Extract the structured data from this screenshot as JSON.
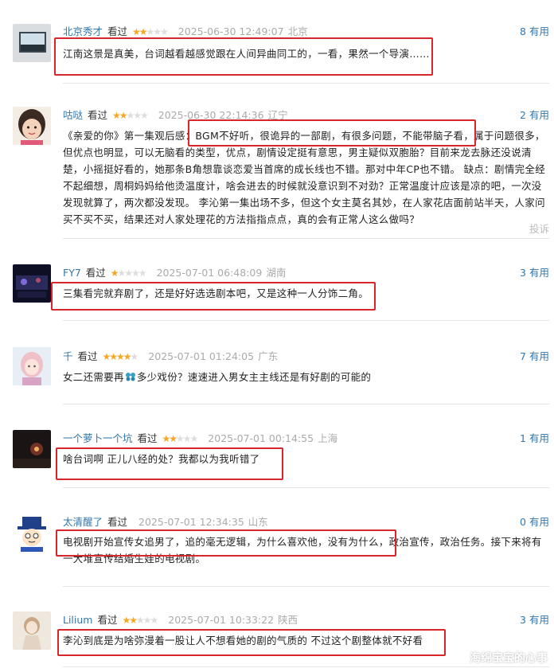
{
  "comments": [
    {
      "username": "北京秀才",
      "status": "看过",
      "rating": 2,
      "time": "2025-06-30 12:49:07",
      "location": "北京",
      "useful_count": "8",
      "useful_label": "有用",
      "text": "江南这景是真美，台词越看越感觉跟在人间异曲同工的，一看，果然一个导演……",
      "avatar_icon": "landscape-photo"
    },
    {
      "username": "咕哒",
      "status": "看过",
      "rating": 2,
      "time": "2025-06-30 22:14:36",
      "location": "辽宁",
      "useful_count": "2",
      "useful_label": "有用",
      "text": "《亲爱的你》第一集观后感：BGM不好听，很诡异的一部剧，有很多问题，不能带脑子看，属于问题很多，但优点也明显，可以无脑看的类型，优点，剧情设定挺有意思，男主疑似双胞胎？目前来龙去脉还没说清楚，小摇挺好看的，她那条B角想靠谈恋爱当首席的成长线也不错。那对中年CP也不错。 缺点：剧情完全经不起细想，周桐妈妈给他烫温度计，啥会进去的时候就没意识到不对劲？正常温度计应该是凉的吧，一次没发现就算了，两次都没发现。 李沁第一集出场不多，但这个女主莫名其妙，在人家花店面前站半天，人家问买不买不买，结果还对人家处理花的方法指指点点，真的会有正常人这么做吗？",
      "report_label": "投诉",
      "avatar_icon": "child-photo"
    },
    {
      "username": "FY7",
      "status": "看过",
      "rating": 1,
      "time": "2025-07-01 06:48:09",
      "location": "湖南",
      "useful_count": "3",
      "useful_label": "有用",
      "text": "三集看完就弃剧了，还是好好选选剧本吧，又是这种一人分饰二角。",
      "avatar_icon": "dark-scene-photo"
    },
    {
      "username": "千",
      "status": "看过",
      "rating": 4,
      "time": "2025-07-01 01:24:05",
      "location": "广东",
      "useful_count": "7",
      "useful_label": "有用",
      "text_before": "女二还需要再",
      "text_after": "多少戏份？速速进入男女主主线还是有好剧的可能的",
      "emoji_icon": "blue-flower-emoji",
      "avatar_icon": "anime-girl-photo"
    },
    {
      "username": "一个萝卜一个坑",
      "status": "看过",
      "rating": 2,
      "time": "2025-07-01 00:14:55",
      "location": "上海",
      "useful_count": "1",
      "useful_label": "有用",
      "text": "啥台词啊 正儿八经的处？我都以为我听错了",
      "avatar_icon": "night-scene-photo"
    },
    {
      "username": "太清醒了",
      "status": "看过",
      "rating": 0,
      "time": "2025-07-01 12:34:35",
      "location": "山东",
      "useful_count": "0",
      "useful_label": "有用",
      "text": "电视剧开始宣传女追男了，追的毫无逻辑，为什么喜欢他，没有为什么，政治宣传，政治任务。接下来将有一大堆宣传结婚生娃的电视剧。",
      "avatar_icon": "cartoon-kid-avatar"
    },
    {
      "username": "Lilium",
      "status": "看过",
      "rating": 2,
      "time": "2025-07-01 10:33:22",
      "location": "陕西",
      "useful_count": "3",
      "useful_label": "有用",
      "text": "李沁到底是为啥弥漫着一股让人不想看她的剧的气质的 不过这个剧整体就不好看",
      "avatar_icon": "doll-photo"
    }
  ],
  "watermark": "海绵宝宝的心事",
  "colors": {
    "link": "#3377aa",
    "star": "#f5a623",
    "highlight_box": "#d9262a"
  }
}
